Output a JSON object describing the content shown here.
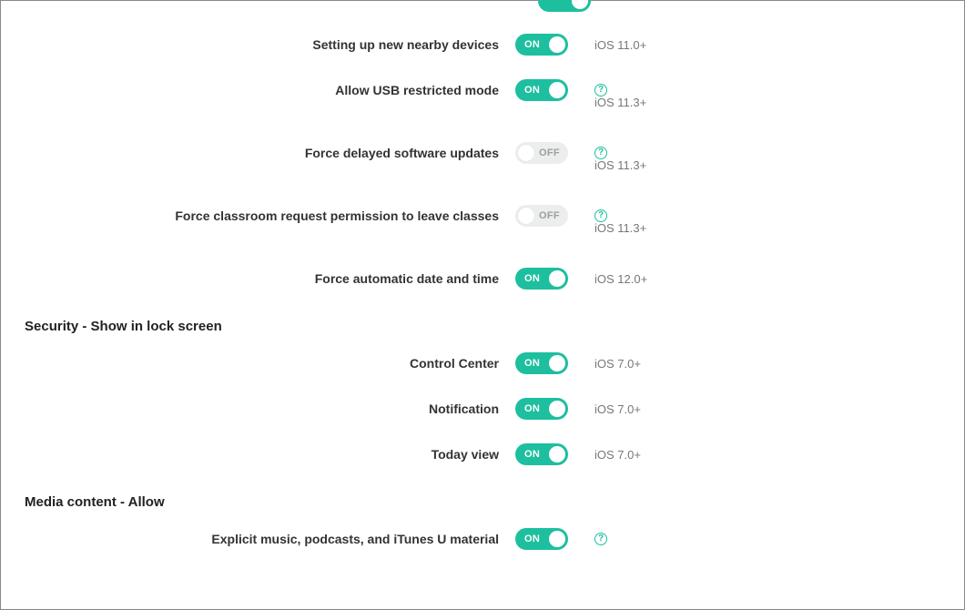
{
  "toggle_on_label": "ON",
  "toggle_off_label": "OFF",
  "settings": [
    {
      "key": "nearby_devices",
      "label": "Setting up new nearby devices",
      "state": "on",
      "help": false,
      "version": "iOS 11.0+",
      "version_below": false
    },
    {
      "key": "usb_restricted",
      "label": "Allow USB restricted mode",
      "state": "on",
      "help": true,
      "version": "iOS 11.3+",
      "version_below": true
    },
    {
      "key": "delayed_updates",
      "label": "Force delayed software updates",
      "state": "off",
      "help": true,
      "version": "iOS 11.3+",
      "version_below": true
    },
    {
      "key": "classroom_leave",
      "label": "Force classroom request permission to leave classes",
      "state": "off",
      "help": true,
      "version": "iOS 11.3+",
      "version_below": true
    },
    {
      "key": "auto_datetime",
      "label": "Force automatic date and time",
      "state": "on",
      "help": false,
      "version": "iOS 12.0+",
      "version_below": false
    }
  ],
  "section_lock": {
    "title": "Security - Show in lock screen",
    "items": [
      {
        "key": "control_center",
        "label": "Control Center",
        "state": "on",
        "version": "iOS 7.0+"
      },
      {
        "key": "notification",
        "label": "Notification",
        "state": "on",
        "version": "iOS 7.0+"
      },
      {
        "key": "today_view",
        "label": "Today view",
        "state": "on",
        "version": "iOS 7.0+"
      }
    ]
  },
  "section_media": {
    "title": "Media content - Allow",
    "items": [
      {
        "key": "explicit",
        "label": "Explicit music, podcasts, and iTunes U material",
        "state": "on",
        "help": true
      }
    ]
  }
}
